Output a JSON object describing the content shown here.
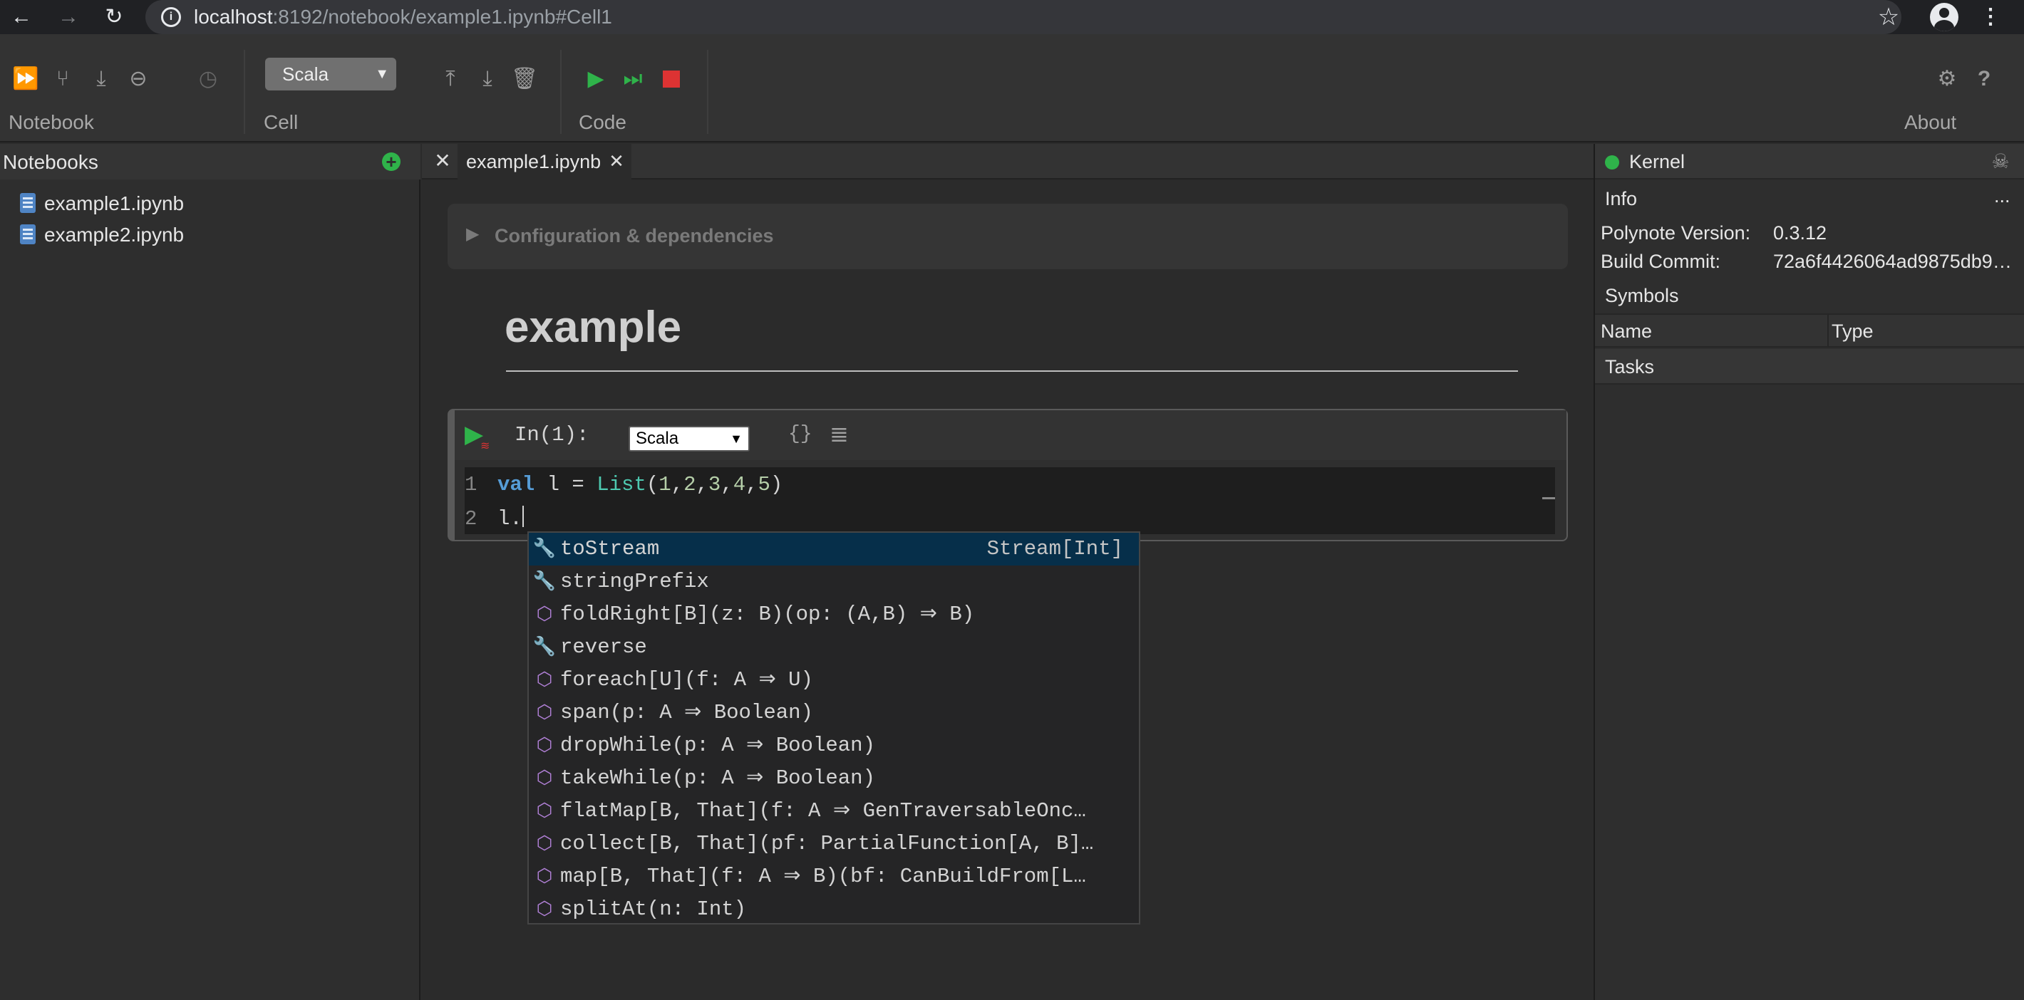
{
  "browser": {
    "url_host": "localhost",
    "url_path": ":8192/notebook/example1.ipynb#Cell1"
  },
  "toolbar": {
    "groups": {
      "notebook": "Notebook",
      "cell": "Cell",
      "code": "Code",
      "about": "About"
    },
    "cell_type_selected": "Scala"
  },
  "left_panel": {
    "title": "Notebooks",
    "files": [
      "example1.ipynb",
      "example2.ipynb"
    ]
  },
  "tabs": [
    {
      "label": "example1.ipynb"
    }
  ],
  "notebook": {
    "config_label": "Configuration & dependencies",
    "title": "example",
    "cell": {
      "prompt": "In(1):",
      "language": "Scala",
      "lines": [
        {
          "num": "1",
          "tokens": [
            {
              "t": "val",
              "c": "kw"
            },
            {
              "t": " l = ",
              "c": "id"
            },
            {
              "t": "List",
              "c": "ty"
            },
            {
              "t": "(",
              "c": "id"
            },
            {
              "t": "1",
              "c": "nm"
            },
            {
              "t": ",",
              "c": "id"
            },
            {
              "t": "2",
              "c": "nm"
            },
            {
              "t": ",",
              "c": "id"
            },
            {
              "t": "3",
              "c": "nm"
            },
            {
              "t": ",",
              "c": "id"
            },
            {
              "t": "4",
              "c": "nm"
            },
            {
              "t": ",",
              "c": "id"
            },
            {
              "t": "5",
              "c": "nm"
            },
            {
              "t": ")",
              "c": "id"
            }
          ]
        },
        {
          "num": "2",
          "tokens": [
            {
              "t": "l.",
              "c": "id"
            }
          ]
        }
      ]
    }
  },
  "autocomplete": [
    {
      "icon": "wrench",
      "text": "toStream",
      "type": "Stream[Int]",
      "selected": true
    },
    {
      "icon": "wrench",
      "text": "stringPrefix"
    },
    {
      "icon": "cube",
      "text": "foldRight[B](z: B)(op: (A,B) ⇒ B)"
    },
    {
      "icon": "wrench",
      "text": "reverse"
    },
    {
      "icon": "cube",
      "text": "foreach[U](f: A ⇒ U)"
    },
    {
      "icon": "cube",
      "text": "span(p: A ⇒ Boolean)"
    },
    {
      "icon": "cube",
      "text": "dropWhile(p: A ⇒ Boolean)"
    },
    {
      "icon": "cube",
      "text": "takeWhile(p: A ⇒ Boolean)"
    },
    {
      "icon": "cube",
      "text": "flatMap[B, That](f: A ⇒ GenTraversableOnc…"
    },
    {
      "icon": "cube",
      "text": "collect[B, That](pf: PartialFunction[A, B]…"
    },
    {
      "icon": "cube",
      "text": "map[B, That](f: A ⇒ B)(bf: CanBuildFrom[L…"
    },
    {
      "icon": "cube",
      "text": "splitAt(n: Int)"
    }
  ],
  "right_panel": {
    "kernel_title": "Kernel",
    "info_title": "Info",
    "info_more": "...",
    "info": [
      {
        "label": "Polynote Version:",
        "value": "0.3.12"
      },
      {
        "label": "Build Commit:",
        "value": "72a6f4426064ad9875db9…"
      }
    ],
    "symbols_title": "Symbols",
    "symbols_columns": [
      "Name",
      "Type"
    ],
    "tasks_title": "Tasks"
  },
  "colors": {
    "accent_green": "#2fb34a",
    "stop_red": "#dd3333",
    "selection_blue": "#062f4a"
  }
}
